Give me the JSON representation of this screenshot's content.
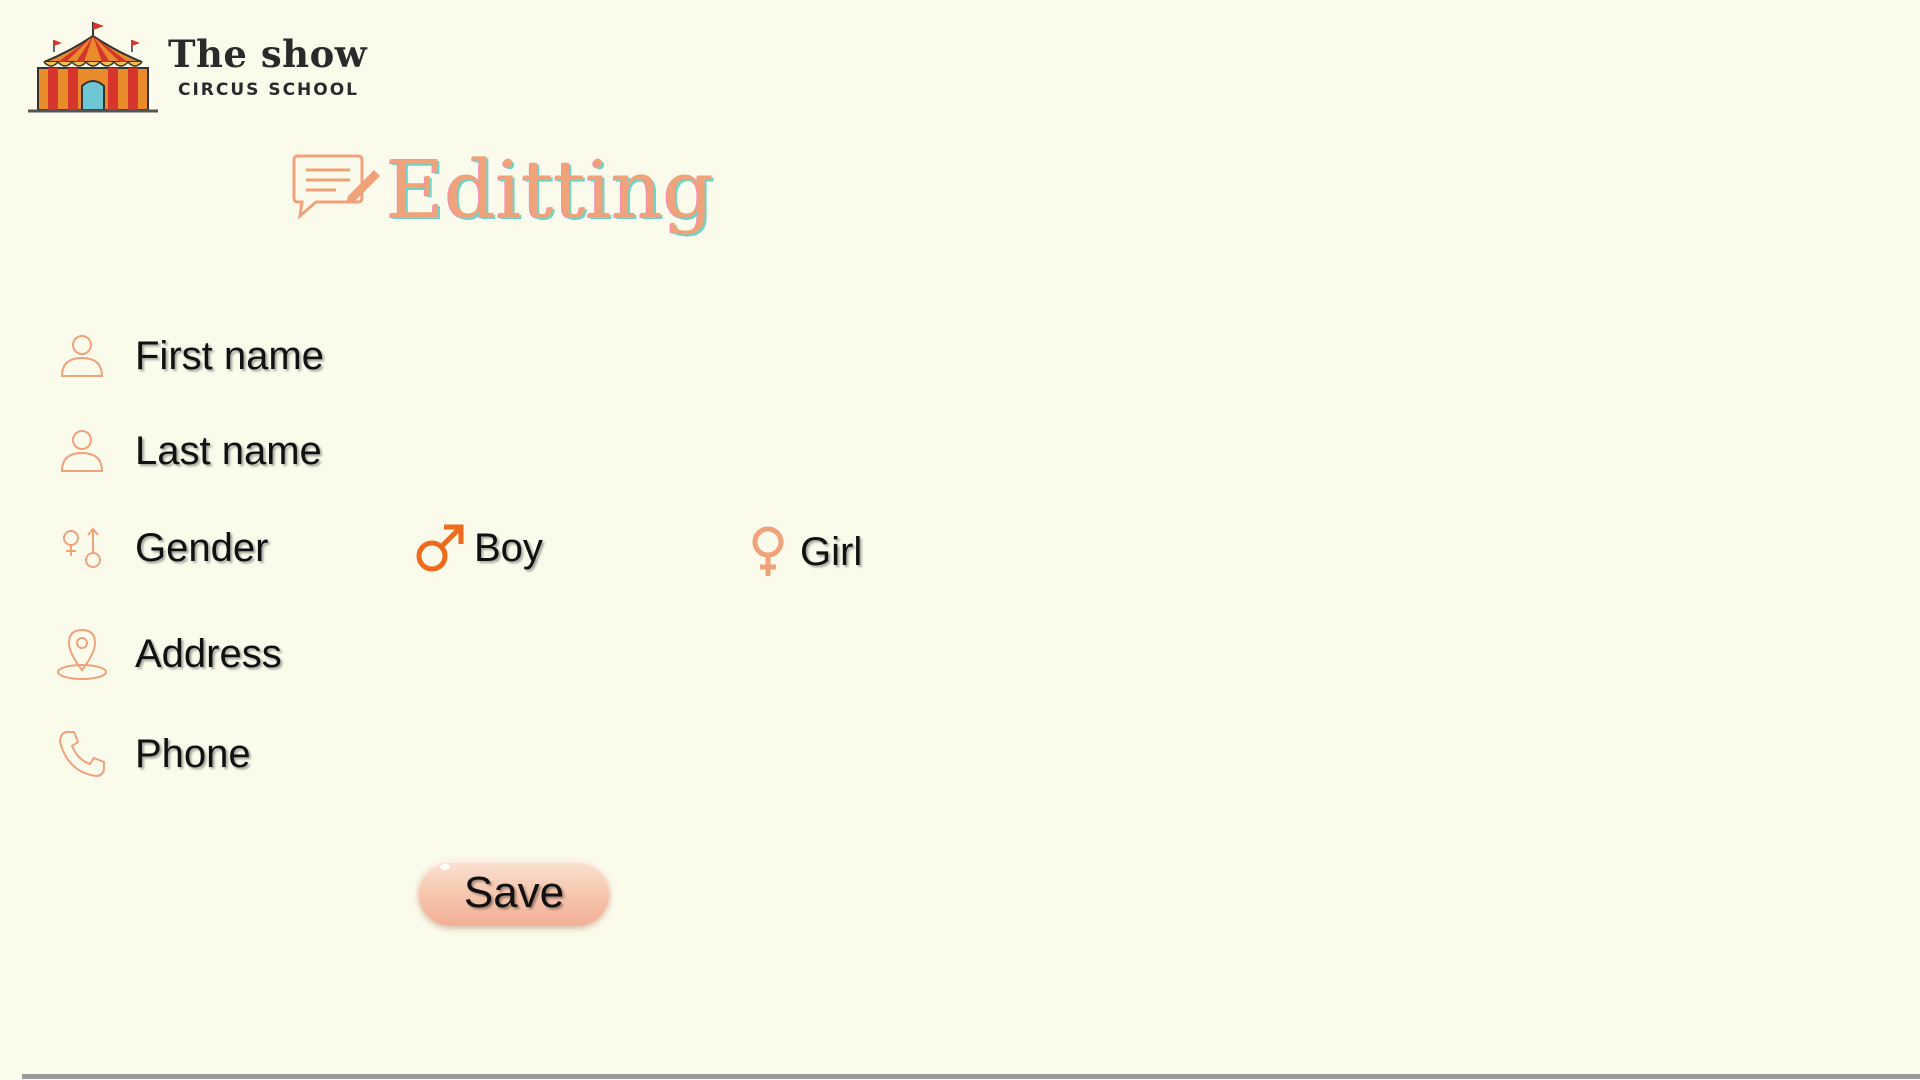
{
  "brand": {
    "title": "The show",
    "subtitle": "CIRCUS SCHOOL",
    "logo_icon": "circus-tent-icon"
  },
  "heading": {
    "title": "Editting",
    "icon": "edit-comment-icon",
    "color": "#f0a27a"
  },
  "form": {
    "first_name": {
      "label": "First name",
      "icon": "person-icon"
    },
    "last_name": {
      "label": "Last name",
      "icon": "person-icon"
    },
    "gender": {
      "label": "Gender",
      "icon": "gender-icon",
      "options": [
        {
          "label": "Boy",
          "icon": "male-symbol-icon",
          "color": "#ee6a1c"
        },
        {
          "label": "Girl",
          "icon": "female-symbol-icon",
          "color": "#f0a27a"
        }
      ]
    },
    "address": {
      "label": "Address",
      "icon": "map-pin-icon"
    },
    "phone": {
      "label": "Phone",
      "icon": "phone-icon"
    }
  },
  "actions": {
    "save_label": "Save"
  },
  "colors": {
    "background": "#fbfbec",
    "icon_outline": "#f0a27a",
    "button": "#f7c9b1"
  }
}
